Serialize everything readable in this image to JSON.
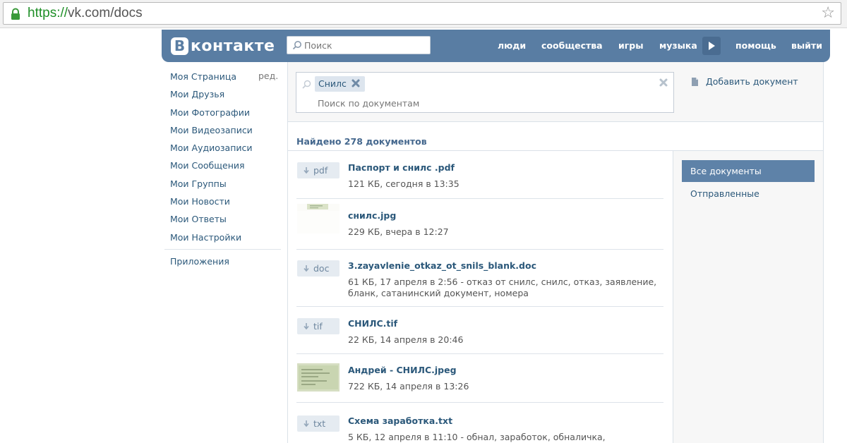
{
  "browser": {
    "url_protocol": "https://",
    "url_rest": "vk.com/docs"
  },
  "header": {
    "logo_letter": "В",
    "logo_text": "контакте",
    "search_placeholder": "Поиск",
    "nav": [
      "люди",
      "сообщества",
      "игры",
      "музыка",
      "помощь",
      "выйти"
    ],
    "brand_color": "#597da3"
  },
  "left_menu": {
    "items": [
      "Моя Страница",
      "Мои Друзья",
      "Мои Фотографии",
      "Мои Видеозаписи",
      "Мои Аудиозаписи",
      "Мои Сообщения",
      "Мои Группы",
      "Мои Новости",
      "Мои Ответы",
      "Мои Настройки"
    ],
    "edit_label": "ред.",
    "apps_label": "Приложения"
  },
  "search": {
    "token": "Снилс",
    "placeholder": "Поиск по документам"
  },
  "add_document_label": "Добавить документ",
  "found_label": "Найдено 278 документов",
  "filters": {
    "active": "Все документы",
    "other": "Отправленные"
  },
  "documents": [
    {
      "type": "pdf",
      "title": "Паспорт и снилс .pdf",
      "meta": "121 КБ, сегодня в 13:35"
    },
    {
      "type": "image",
      "title": "снилс.jpg",
      "meta": "229 КБ, вчера в 12:27"
    },
    {
      "type": "doc",
      "title": "3.zayavlenie_otkaz_ot_snils_blank.doc",
      "meta": "61 КБ, 17 апреля в 2:56 - отказ от снилс, снилс, отказ, заявление, бланк, сатанинский документ, номера"
    },
    {
      "type": "tif",
      "title": "СНИЛС.tif",
      "meta": "22 КБ, 14 апреля в 20:46"
    },
    {
      "type": "image",
      "title": "Андрей - СНИЛС.jpeg",
      "meta": "722 КБ, 14 апреля в 13:26"
    },
    {
      "type": "txt",
      "title": "Схема заработка.txt",
      "meta": "5 КБ, 12 апреля в 11:10 - обнал, заработок, обналичка,"
    }
  ]
}
